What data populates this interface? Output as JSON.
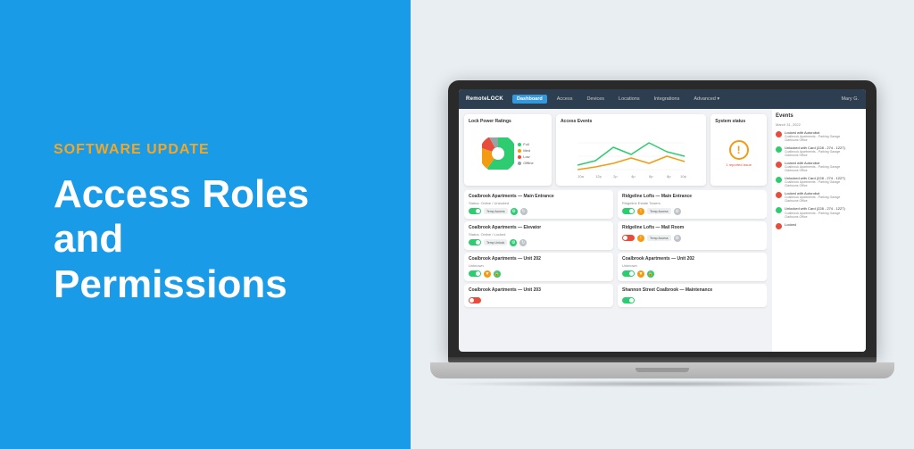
{
  "left": {
    "label": "SOFTWARE UPDATE",
    "heading_line1": "Access Roles",
    "heading_line2": "and Permissions"
  },
  "laptop": {
    "navbar": {
      "logo": "RemoteLOCK",
      "tabs": [
        "Dashboard",
        "Access",
        "Devices",
        "Locations",
        "Integrations",
        "Advanced"
      ],
      "active_tab": "Dashboard",
      "user": "Mary G."
    },
    "widgets": {
      "lock_power": {
        "title": "Lock Power Ratings",
        "legend": [
          {
            "label": "Full",
            "color": "#2ecc71"
          },
          {
            "label": "Med",
            "color": "#f39c12"
          },
          {
            "label": "Low",
            "color": "#e74c3c"
          },
          {
            "label": "Offline",
            "color": "#95a5a6"
          }
        ]
      },
      "access_events": {
        "title": "Access Events"
      },
      "system_status": {
        "title": "System status",
        "status": "1 reported issue"
      }
    },
    "events_sidebar": {
      "title": "Events",
      "date": "March 31, 2022",
      "items": [
        {
          "type": "locked",
          "title": "Locked with Autorobot",
          "sub": "Coalbrook Apartments - Parking Garage\nClarksons Office",
          "color": "red"
        },
        {
          "type": "unlocked",
          "title": "Unlocked with Card (228 - 274 - 1227)",
          "sub": "Coalbrook Apartments - Parking Garage\nClarksons Office",
          "color": "green"
        },
        {
          "type": "locked",
          "title": "Locked with Autorobot",
          "sub": "Coalbrook Apartments - Parking Garage\nClarksons Office",
          "color": "red"
        },
        {
          "type": "unlocked",
          "title": "Unlocked with Card (228 - 274 - 1227)",
          "sub": "Coalbrook Apartments - Parking Garage\nClarksons Office",
          "color": "green"
        },
        {
          "type": "locked",
          "title": "Locked with Autorobot",
          "sub": "Coalbrook Apartments - Parking Garage\nClarksons Office",
          "color": "red"
        },
        {
          "type": "unlocked",
          "title": "Unlocked with Card (228 - 274 - 1227)",
          "sub": "Coalbrook Apartments - Parking Garage\nClarksons Office",
          "color": "green"
        },
        {
          "type": "locked",
          "title": "Locked",
          "sub": "",
          "color": "red"
        }
      ]
    },
    "devices": [
      [
        {
          "name": "Coalbrook Apartments — Main Entrance",
          "sub": "Status: Online / Unlocked",
          "toggle": "on",
          "has_btn": true
        },
        {
          "name": "Ridgeline Lofts — Main Entrance",
          "sub": "Ridgeline Estate Towers",
          "toggle": "on",
          "has_btn": true
        }
      ],
      [
        {
          "name": "Coalbrook Apartments — Elevator",
          "sub": "Status: Online / Locked",
          "toggle": "on",
          "has_btn": true
        },
        {
          "name": "Ridgeline Lofts — Mail Room",
          "sub": "",
          "toggle": "off",
          "has_btn": true
        }
      ],
      [
        {
          "name": "Coalbrook Apartments — Unit 202",
          "sub": "Unknown",
          "toggle": "on",
          "has_btn": true
        },
        {
          "name": "Coalbrook Apartments — Unit 202",
          "sub": "Unknown",
          "toggle": "on",
          "has_btn": true
        }
      ],
      [
        {
          "name": "Coalbrook Apartments — Unit 203",
          "sub": "",
          "toggle": "off",
          "has_btn": false
        },
        {
          "name": "Shannon Street Coalbrook — Maintenance",
          "sub": "",
          "toggle": "on",
          "has_btn": false
        }
      ]
    ]
  }
}
